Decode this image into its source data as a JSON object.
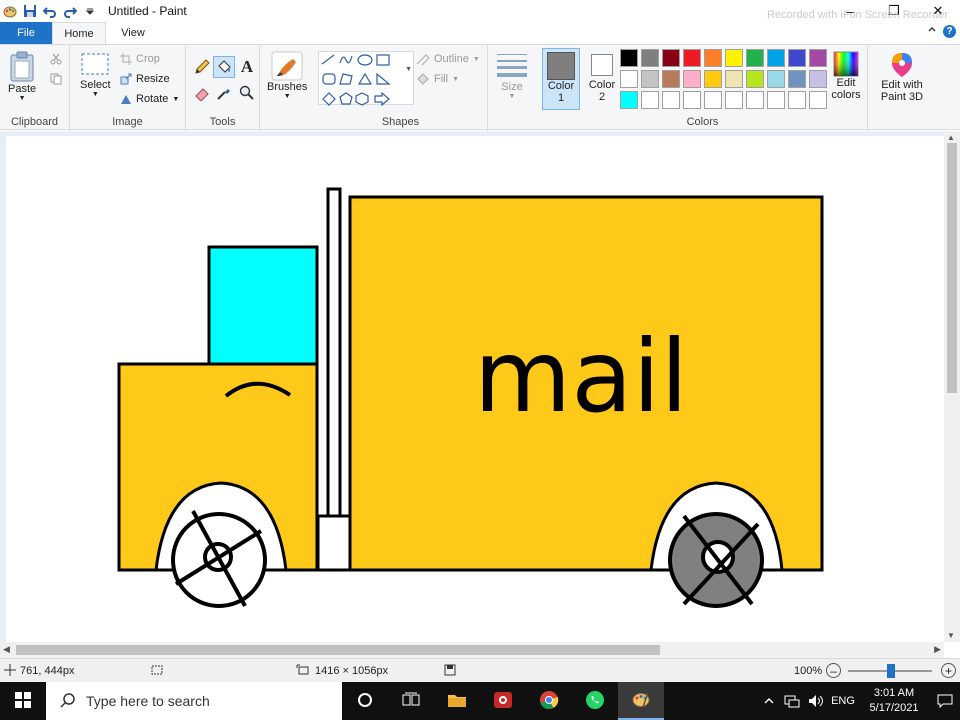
{
  "window": {
    "title": "Untitled - Paint",
    "watermark": "Recorded with iFun Screen Recorder"
  },
  "tabs": [
    {
      "label": "File"
    },
    {
      "label": "Home"
    },
    {
      "label": "View"
    }
  ],
  "ribbon": {
    "clipboard": {
      "paste_label": "Paste",
      "group_label": "Clipboard"
    },
    "image": {
      "select_label": "Select",
      "crop_label": "Crop",
      "resize_label": "Resize",
      "rotate_label": "Rotate",
      "group_label": "Image"
    },
    "tools": {
      "group_label": "Tools"
    },
    "brushes": {
      "label": "Brushes"
    },
    "shapes": {
      "outline_label": "Outline",
      "fill_label": "Fill",
      "group_label": "Shapes"
    },
    "size": {
      "label": "Size"
    },
    "colors": {
      "color1_label": "Color",
      "color1_num": "1",
      "color2_label": "Color",
      "color2_num": "2",
      "edit_colors_line1": "Edit",
      "edit_colors_line2": "colors",
      "group_label": "Colors",
      "color1_value": "#7f7f7f",
      "color2_value": "#ffffff",
      "palette": [
        "#000000",
        "#7f7f7f",
        "#880015",
        "#ed1c24",
        "#ff7f27",
        "#fff200",
        "#22b14c",
        "#00a2e8",
        "#3f48cc",
        "#a349a4",
        "#ffffff",
        "#c3c3c3",
        "#b97a57",
        "#ffaec9",
        "#ffc90e",
        "#efe4b0",
        "#b5e61d",
        "#99d9ea",
        "#7092be",
        "#c8bfe7",
        "#00ffff",
        "#ffffff",
        "#ffffff",
        "#ffffff",
        "#ffffff",
        "#ffffff",
        "#ffffff",
        "#ffffff",
        "#ffffff",
        "#ffffff"
      ]
    },
    "paint3d": {
      "line1": "Edit with",
      "line2": "Paint 3D"
    }
  },
  "canvas": {
    "truck_text": "mail",
    "body_color": "#ffc91a",
    "window_color": "#00ffff",
    "wheel_back_color": "#808080"
  },
  "status": {
    "cursor_position": "761, 444px",
    "image_size": "1416 × 1056px",
    "zoom": "100%"
  },
  "taskbar": {
    "search_placeholder": "Type here to search",
    "language": "ENG",
    "time": "3:01 AM",
    "date": "5/17/2021"
  }
}
